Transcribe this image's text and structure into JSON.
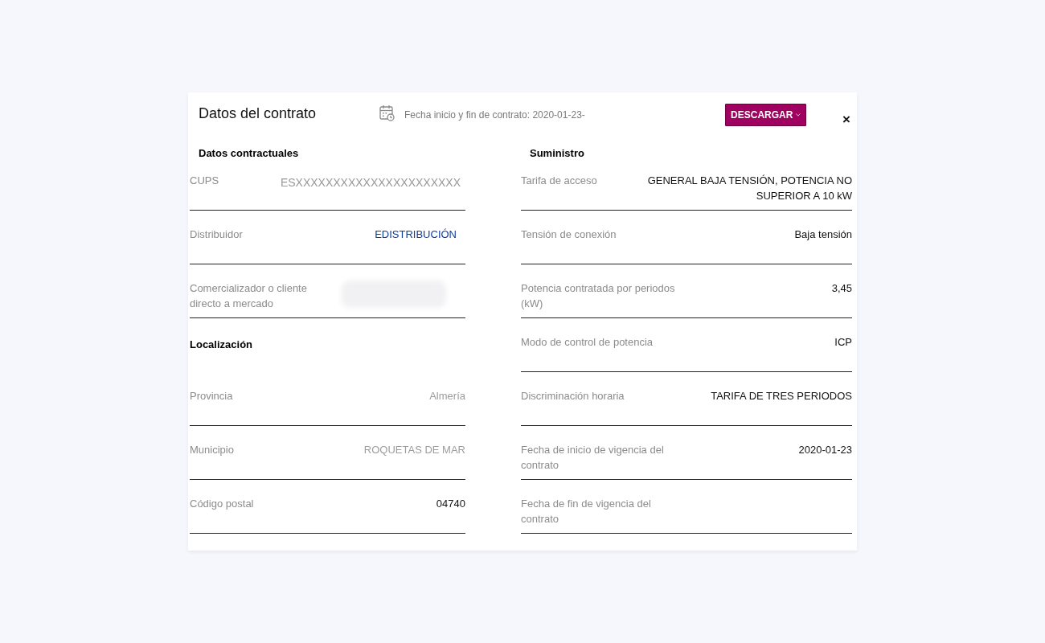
{
  "dialog": {
    "title": "Datos del contrato",
    "contract_dates": "Fecha inicio y fin de contrato: 2020-01-23-",
    "download_button": "DESCARGAR",
    "close": "×"
  },
  "columns": [
    {
      "sections": [
        {
          "heading": "Datos contractuales",
          "rows": [
            {
              "label": "CUPS",
              "value": "ESXXXXXXXXXXXXXXXXXXXXXX",
              "kind": "muted"
            },
            {
              "label": "Distribuidor",
              "value": "EDISTRIBUCIÓN",
              "kind": "link"
            },
            {
              "label": "Comercializador o cliente directo a mercado",
              "kind": "redacted"
            }
          ]
        },
        {
          "heading": "Localización",
          "rows": [
            {
              "label": "Provincia",
              "value": "Almería",
              "kind": "blurred"
            },
            {
              "label": "Municipio",
              "value": "ROQUETAS DE MAR",
              "kind": "blurred"
            },
            {
              "label": "Código postal",
              "value": "04740",
              "kind": "plain"
            }
          ]
        }
      ]
    },
    {
      "sections": [
        {
          "heading": "Suministro",
          "rows": [
            {
              "label": "Tarifa de acceso",
              "value": "GENERAL BAJA TENSIÓN, POTENCIA NO SUPERIOR A 10 kW",
              "kind": "plain"
            },
            {
              "label": "Tensión de conexión",
              "value": "Baja tensión",
              "kind": "plain"
            },
            {
              "label": "Potencia contratada por periodos (kW)",
              "value": "3,45",
              "kind": "plain"
            },
            {
              "label": "Modo de control de potencia",
              "value": "ICP",
              "kind": "plain"
            },
            {
              "label": "Discriminación horaria",
              "value": "TARIFA DE TRES PERIODOS",
              "kind": "plain"
            },
            {
              "label": "Fecha de inicio de vigencia del contrato",
              "value": "2020-01-23",
              "kind": "plain"
            },
            {
              "label": "Fecha de fin de vigencia del contrato",
              "kind": "empty"
            }
          ]
        }
      ]
    }
  ]
}
